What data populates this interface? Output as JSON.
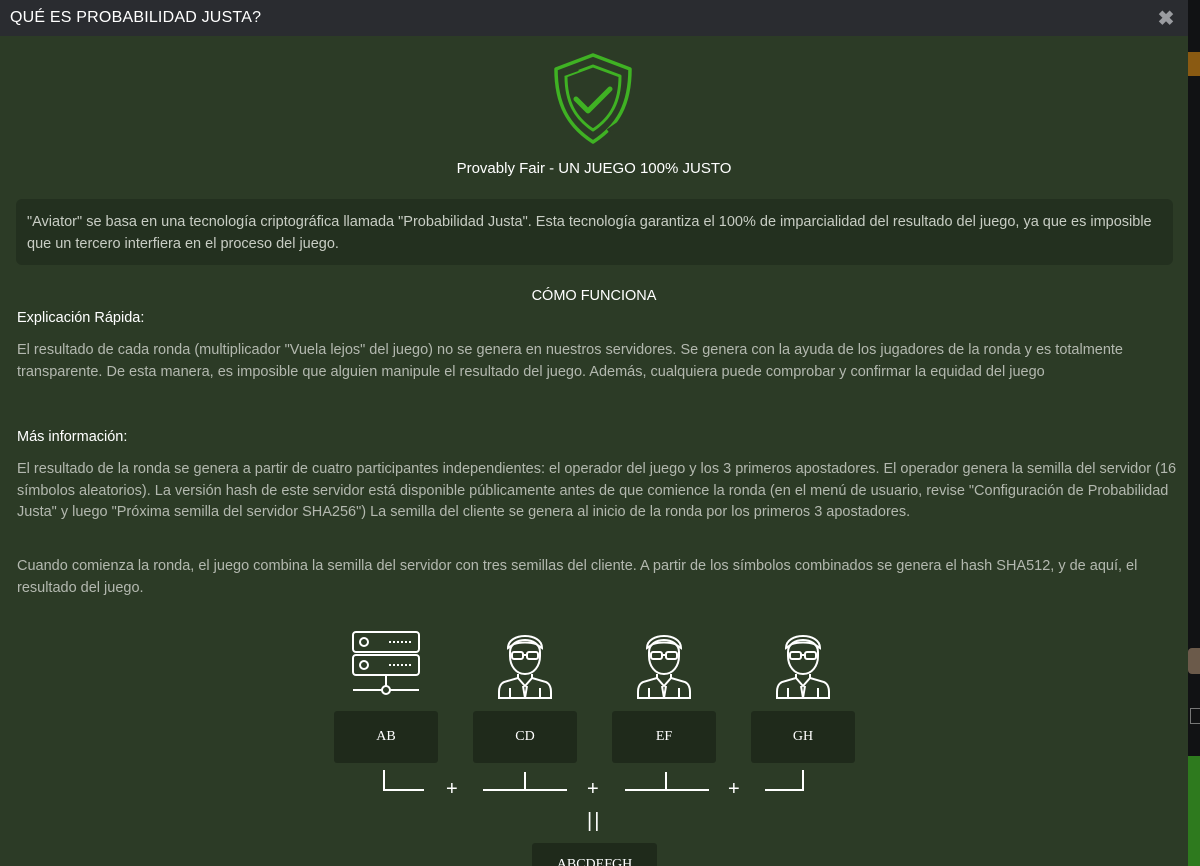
{
  "modal": {
    "title": "QUÉ ES PROBABILIDAD JUSTA?",
    "close_glyph": "✖",
    "subtitle": "Provably Fair - UN JUEGO 100% JUSTO",
    "intro": "\"Aviator\" se basa en una tecnología criptográfica llamada \"Probabilidad Justa\". Esta tecnología garantiza el 100% de imparcialidad del resultado del juego, ya que es imposible que un tercero interfiera en el proceso del juego.",
    "section_title": "CÓMO FUNCIONA",
    "quick_label": "Explicación Rápida:",
    "quick_text": "El resultado de cada ronda (multiplicador \"Vuela lejos\" del juego) no se genera en nuestros servidores. Se genera con la ayuda de los jugadores de la ronda y es totalmente transparente. De esta manera, es imposible que alguien manipule el resultado del juego. Además, cualquiera puede comprobar y confirmar la equidad del juego",
    "more_label": "Más información:",
    "more_text_1": "El resultado de la ronda se genera a partir de cuatro participantes independientes: el operador del juego y los 3 primeros apostadores. El operador genera la semilla del servidor (16 símbolos aleatorios). La versión hash de este servidor está disponible públicamente antes de que comience la ronda (en el menú de usuario, revise \"Configuración de Probabilidad Justa\" y luego \"Próxima semilla del servidor SHA256\") La semilla del cliente se genera al inicio de la ronda por los primeros 3 apostadores.",
    "more_text_2": "Cuando comienza la ronda, el juego combina la semilla del servidor con tres semillas del cliente. A partir de los símbolos combinados se genera el hash SHA512, y de aquí, el resultado del juego."
  },
  "diagram": {
    "nodes": [
      {
        "icon": "server-icon",
        "label": "AB"
      },
      {
        "icon": "player-icon",
        "label": "CD"
      },
      {
        "icon": "player-icon",
        "label": "EF"
      },
      {
        "icon": "player-icon",
        "label": "GH"
      }
    ],
    "plus": "+",
    "equals": "||",
    "result": "ABCDEFGH"
  },
  "colors": {
    "modal_bg": "#2c3b26",
    "header_bg": "#2a2c30",
    "shield_green": "#3fb223",
    "box_bg": "#1f2a1b"
  }
}
